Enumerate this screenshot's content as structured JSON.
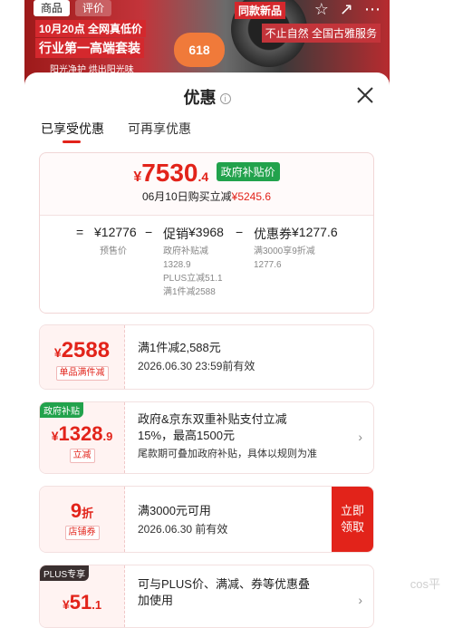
{
  "background": {
    "tabs": [
      "商品",
      "评价"
    ],
    "line1": "10月20点 全网真低价",
    "line2": "行业第一高端套装",
    "line3": "阳光净护   烘出阳光味",
    "badge": "618",
    "tag2": "同款新品",
    "right_text": "不止自然 全国古雅服务"
  },
  "sheet": {
    "title": "优惠",
    "tabs": [
      {
        "label": "已享受优惠",
        "active": true
      },
      {
        "label": "可再享优惠",
        "active": false
      }
    ]
  },
  "summary": {
    "currency": "¥",
    "price_main": "7530",
    "price_decimal": ".4",
    "gov_tag": "政府补贴价",
    "date_prefix": "06月10日购买立减",
    "date_amount": "¥5245.6",
    "calc": {
      "eq": "=",
      "presale_amount": "¥12776",
      "presale_label": "预售价",
      "minus1": "−",
      "promo_label": "促销",
      "promo_amount": "¥3968",
      "promo_details": [
        "政府补贴减",
        "1328.9",
        "PLUS立减51.1",
        "满1件减2588"
      ],
      "minus2": "−",
      "coupon_label": "优惠券",
      "coupon_amount": "¥1277.6",
      "coupon_details": [
        "满3000享9折减",
        "1277.6"
      ]
    }
  },
  "coupons": [
    {
      "amount_currency": "¥",
      "amount": "2588",
      "pill": "单品满件减",
      "main": "满1件减2,588元",
      "sub": "2026.06.30 23:59前有效"
    },
    {
      "corner": "政府补贴",
      "amount_currency": "¥",
      "amount": "1328",
      "amount_decimal": ".9",
      "pill": "立减",
      "main_lines": [
        "政府&京东双重补贴支付立减",
        "15%，最高1500元"
      ],
      "sub": "尾款期可叠加政府补贴，具体以规则为准",
      "chevron": "›"
    },
    {
      "amount": "9",
      "unit": "折",
      "pill": "店铺券",
      "main": "满3000元可用",
      "sub": "2026.06.30 前有效",
      "button": [
        "立即",
        "领取"
      ]
    },
    {
      "corner": "PLUS专享",
      "amount_currency": "¥",
      "amount": "51",
      "amount_decimal": ".1",
      "main_lines": [
        "可与PLUS价、满减、券等优惠叠",
        "加使用"
      ],
      "chevron": "›"
    }
  ],
  "watermark": "cos平"
}
